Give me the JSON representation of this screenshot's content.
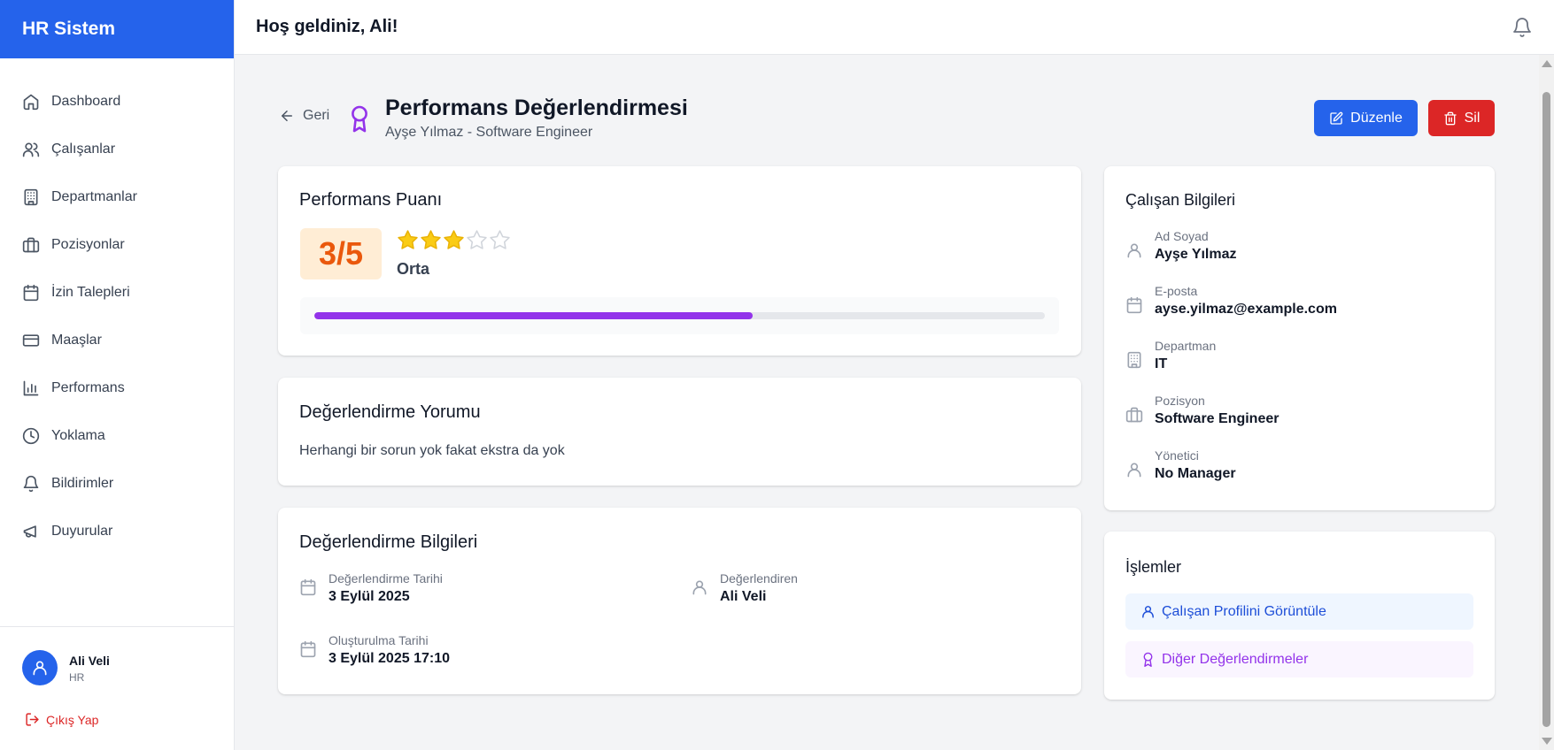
{
  "app": {
    "brand": "HR Sistem"
  },
  "sidebar": {
    "items": [
      {
        "label": "Dashboard",
        "icon": "home-icon"
      },
      {
        "label": "Çalışanlar",
        "icon": "users-icon"
      },
      {
        "label": "Departmanlar",
        "icon": "building-icon"
      },
      {
        "label": "Pozisyonlar",
        "icon": "briefcase-icon"
      },
      {
        "label": "İzin Talepleri",
        "icon": "calendar-icon"
      },
      {
        "label": "Maaşlar",
        "icon": "credit-card-icon"
      },
      {
        "label": "Performans",
        "icon": "bar-chart-icon"
      },
      {
        "label": "Yoklama",
        "icon": "clock-icon"
      },
      {
        "label": "Bildirimler",
        "icon": "bell-icon"
      },
      {
        "label": "Duyurular",
        "icon": "megaphone-icon"
      }
    ],
    "user": {
      "name": "Ali Veli",
      "role": "HR"
    },
    "logout_label": "Çıkış Yap"
  },
  "topbar": {
    "welcome": "Hoş geldiniz, Ali!"
  },
  "header": {
    "back_label": "Geri",
    "title": "Performans Değerlendirmesi",
    "subtitle": "Ayşe Yılmaz - Software Engineer",
    "edit_label": "Düzenle",
    "delete_label": "Sil"
  },
  "score": {
    "title": "Performans Puanı",
    "value_text": "3/5",
    "rating": 3,
    "max_rating": 5,
    "rating_label": "Orta",
    "progress_fraction": 0.6
  },
  "comment": {
    "title": "Değerlendirme Yorumu",
    "text": "Herhangi bir sorun yok fakat ekstra da yok"
  },
  "evaluation_info": {
    "title": "Değerlendirme Bilgileri",
    "date_label": "Değerlendirme Tarihi",
    "date_value": "3 Eylül 2025",
    "evaluator_label": "Değerlendiren",
    "evaluator_value": "Ali Veli",
    "created_label": "Oluşturulma Tarihi",
    "created_value": "3 Eylül 2025 17:10"
  },
  "employee": {
    "title": "Çalışan Bilgileri",
    "fields": [
      {
        "label": "Ad Soyad",
        "value": "Ayşe Yılmaz",
        "icon": "user-icon"
      },
      {
        "label": "E-posta",
        "value": "ayse.yilmaz@example.com",
        "icon": "calendar-icon"
      },
      {
        "label": "Departman",
        "value": "IT",
        "icon": "building-icon"
      },
      {
        "label": "Pozisyon",
        "value": "Software Engineer",
        "icon": "briefcase-icon"
      },
      {
        "label": "Yönetici",
        "value": "No Manager",
        "icon": "user-icon"
      }
    ]
  },
  "actions": {
    "title": "İşlemler",
    "view_profile_label": "Çalışan Profilini Görüntüle",
    "other_evaluations_label": "Diğer Değerlendirmeler"
  },
  "colors": {
    "primary": "#2563eb",
    "danger": "#dc2626",
    "accent_purple": "#9333ea",
    "score_orange": "#ea580c",
    "star_yellow": "#facc15"
  }
}
